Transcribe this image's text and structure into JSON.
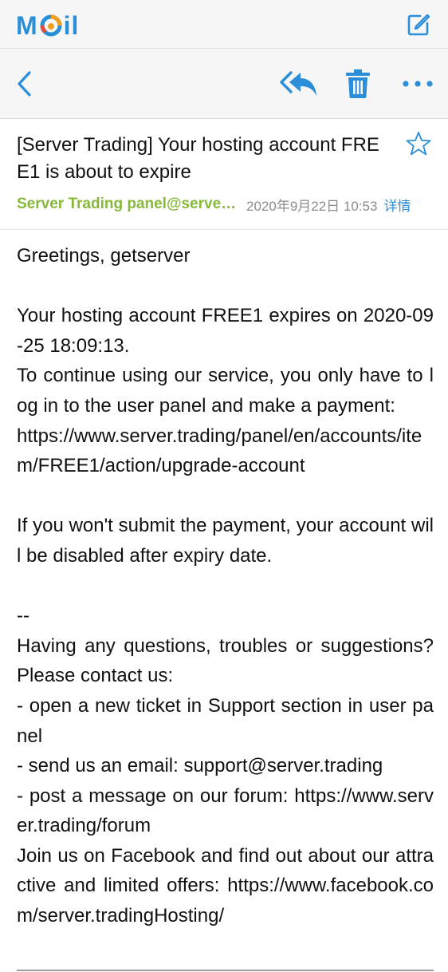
{
  "brand": {
    "name_prefix": "M",
    "name_suffix": "il",
    "accent_color": "#2a8fd8",
    "icons": {
      "compose": "compose-icon"
    }
  },
  "toolbar": {
    "icons": {
      "back": "chevron-left-icon",
      "reply": "reply-all-icon",
      "delete": "trash-icon",
      "more": "more-horizontal-icon"
    }
  },
  "message": {
    "subject": "[Server Trading] Your hosting account FREE1 is about to expire",
    "sender": "Server Trading panel@server.trading",
    "sender_color": "#86b93a",
    "date": "2020年9月22日 10:53",
    "details_label": "详情",
    "star_icon": "star-outline-icon",
    "body": {
      "greeting": "Greetings, getserver",
      "line_expiry": "Your hosting account FREE1 expires on 2020-09-25 18:09:13.",
      "line_continue": "To continue using our service, you only have to log in to the user panel and make a payment:",
      "link_upgrade": "https://www.server.trading/panel/en/accounts/item/FREE1/action/upgrade-account",
      "line_disabled": "If you won't submit the payment, your account will be disabled after expiry date.",
      "separator": "--",
      "line_questions": "Having any questions, troubles or suggestions? Please contact us:",
      "item_ticket": "- open a new ticket in Support section in user panel",
      "item_email": "- send us an email: support@server.trading",
      "item_forum": "- post a message on our forum: https://www.server.trading/forum",
      "line_facebook": "Join us on Facebook and find out about our attractive and limited offers: https://www.facebook.com/server.tradingHosting/"
    }
  }
}
